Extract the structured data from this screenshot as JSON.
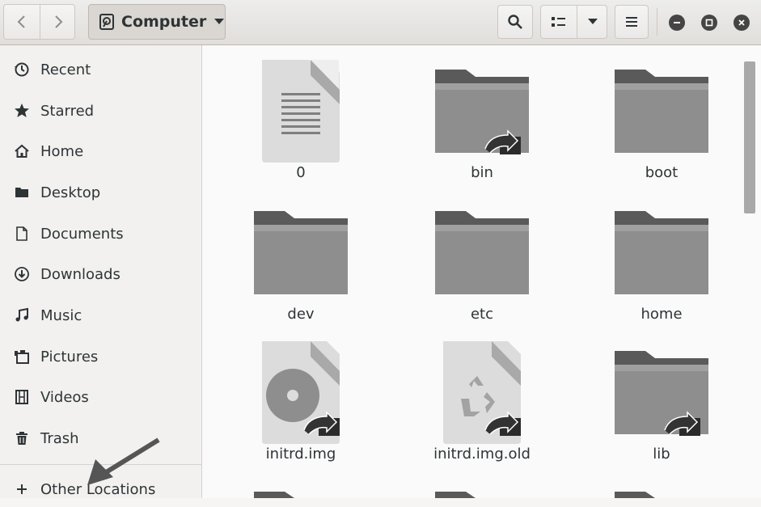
{
  "header": {
    "path_label": "Computer"
  },
  "icons": {
    "back": "back-chevron-icon",
    "forward": "forward-chevron-icon",
    "drive": "drive-icon",
    "search": "search-icon",
    "view": "list-view-icon",
    "menu": "hamburger-menu-icon"
  },
  "sidebar": {
    "items": [
      {
        "label": "Recent",
        "icon": "clock-icon"
      },
      {
        "label": "Starred",
        "icon": "star-icon"
      },
      {
        "label": "Home",
        "icon": "home-icon"
      },
      {
        "label": "Desktop",
        "icon": "desktop-folder-icon"
      },
      {
        "label": "Documents",
        "icon": "document-icon"
      },
      {
        "label": "Downloads",
        "icon": "download-icon"
      },
      {
        "label": "Music",
        "icon": "music-icon"
      },
      {
        "label": "Pictures",
        "icon": "pictures-icon"
      },
      {
        "label": "Videos",
        "icon": "film-icon"
      },
      {
        "label": "Trash",
        "icon": "trash-icon"
      }
    ],
    "other_locations": "Other Locations"
  },
  "files": [
    {
      "name": "0",
      "type": "text-file"
    },
    {
      "name": "bin",
      "type": "folder-link"
    },
    {
      "name": "boot",
      "type": "folder"
    },
    {
      "name": "dev",
      "type": "folder"
    },
    {
      "name": "etc",
      "type": "folder"
    },
    {
      "name": "home",
      "type": "folder"
    },
    {
      "name": "initrd.img",
      "type": "disc-image-link"
    },
    {
      "name": "initrd.img.old",
      "type": "archive-link"
    },
    {
      "name": "lib",
      "type": "folder-link"
    }
  ],
  "colors": {
    "folder": "#8e8e8e",
    "folder_tab": "#5a5a5a",
    "file": "#dcdcdc",
    "accent_arrow": "#555555"
  }
}
